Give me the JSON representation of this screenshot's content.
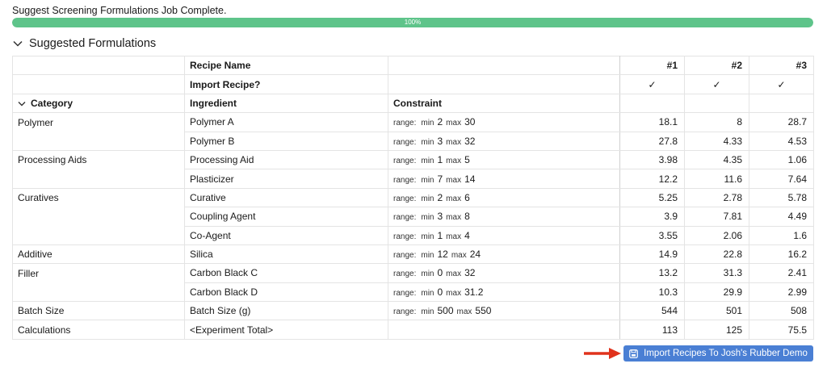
{
  "status": {
    "message": "Suggest Screening Formulations Job Complete.",
    "progress_percent": 100,
    "progress_label": "100%",
    "progress_color": "#5ec48a"
  },
  "section": {
    "title": "Suggested Formulations",
    "toggle_icon": "chevron-down-icon"
  },
  "table": {
    "recipe_name_label": "Recipe Name",
    "import_recipe_label": "Import Recipe?",
    "recipes": [
      "#1",
      "#2",
      "#3"
    ],
    "import_checks": [
      "✓",
      "✓",
      "✓"
    ],
    "headers": {
      "category": "Category",
      "ingredient": "Ingredient",
      "constraint": "Constraint"
    },
    "constraint_labels": {
      "range": "range:",
      "min": "min",
      "max": "max"
    },
    "rows": [
      {
        "category": "Polymer",
        "ingredient": "Polymer A",
        "min": "2",
        "max": "30",
        "values": [
          "18.1",
          "8",
          "28.7"
        ]
      },
      {
        "category": "",
        "ingredient": "Polymer B",
        "min": "3",
        "max": "32",
        "values": [
          "27.8",
          "4.33",
          "4.53"
        ]
      },
      {
        "category": "Processing Aids",
        "ingredient": "Processing Aid",
        "min": "1",
        "max": "5",
        "values": [
          "3.98",
          "4.35",
          "1.06"
        ]
      },
      {
        "category": "",
        "ingredient": "Plasticizer",
        "min": "7",
        "max": "14",
        "values": [
          "12.2",
          "11.6",
          "7.64"
        ]
      },
      {
        "category": "Curatives",
        "ingredient": "Curative",
        "min": "2",
        "max": "6",
        "values": [
          "5.25",
          "2.78",
          "5.78"
        ]
      },
      {
        "category": "",
        "ingredient": "Coupling Agent",
        "min": "3",
        "max": "8",
        "values": [
          "3.9",
          "7.81",
          "4.49"
        ]
      },
      {
        "category": "",
        "ingredient": "Co-Agent",
        "min": "1",
        "max": "4",
        "values": [
          "3.55",
          "2.06",
          "1.6"
        ]
      },
      {
        "category": "Additive",
        "ingredient": "Silica",
        "min": "12",
        "max": "24",
        "values": [
          "14.9",
          "22.8",
          "16.2"
        ]
      },
      {
        "category": "Filler",
        "ingredient": "Carbon Black C",
        "min": "0",
        "max": "32",
        "values": [
          "13.2",
          "31.3",
          "2.41"
        ]
      },
      {
        "category": "",
        "ingredient": "Carbon Black D",
        "min": "0",
        "max": "31.2",
        "values": [
          "10.3",
          "29.9",
          "2.99"
        ]
      },
      {
        "category": "Batch Size",
        "ingredient": "Batch Size (g)",
        "min": "500",
        "max": "550",
        "values": [
          "544",
          "501",
          "508"
        ]
      },
      {
        "category": "Calculations",
        "ingredient": "<Experiment Total>",
        "min": "",
        "max": "",
        "values": [
          "113",
          "125",
          "75.5"
        ]
      }
    ]
  },
  "import_button": {
    "label": "Import Recipes To Josh's Rubber Demo",
    "icon": "save-icon",
    "color": "#4a7fd4"
  },
  "annotation_arrow": {
    "color": "#e0321c"
  }
}
